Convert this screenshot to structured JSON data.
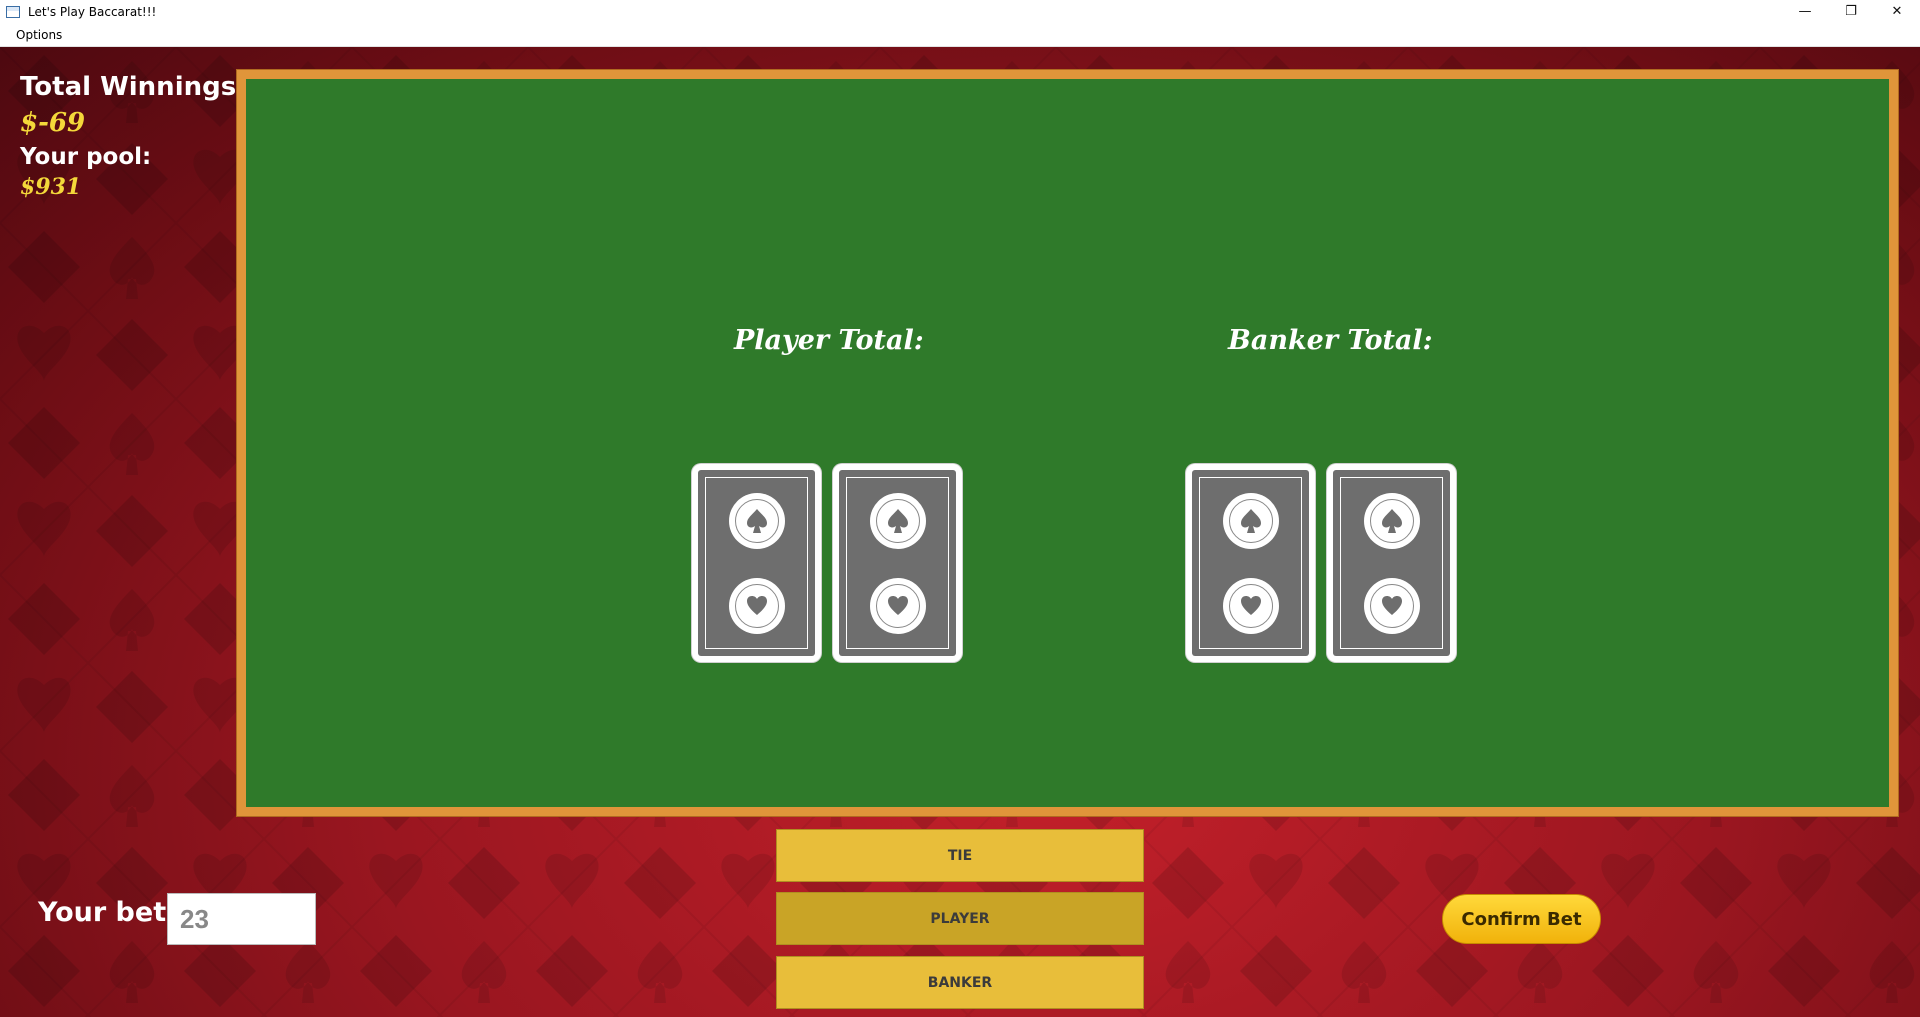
{
  "window": {
    "title": "Let's Play Baccarat!!!",
    "minimize_glyph": "—",
    "restore_glyph": "❐",
    "close_glyph": "✕"
  },
  "menu": {
    "items": [
      {
        "label": "Options"
      }
    ]
  },
  "stats": {
    "winnings_label": "Total Winnings:",
    "winnings_value": "$-69",
    "pool_label": "Your pool:",
    "pool_value": "$931"
  },
  "table": {
    "player_total_label": "Player Total:",
    "banker_total_label": "Banker Total:",
    "player_cards": [
      {
        "face": "back"
      },
      {
        "face": "back"
      }
    ],
    "banker_cards": [
      {
        "face": "back"
      },
      {
        "face": "back"
      }
    ]
  },
  "bet": {
    "label": "Your bet:",
    "value": "23"
  },
  "choices": {
    "tie": "TIE",
    "player": "PLAYER",
    "banker": "BANKER",
    "selected": "PLAYER"
  },
  "confirm": {
    "label": "Confirm Bet"
  },
  "colors": {
    "felt": "#2f7a2a",
    "table_border": "#e0953a",
    "stat_value": "#f4d83a",
    "choice_button": "#e8be3a",
    "confirm_button": "#f1b20b",
    "background_red": "#9a1620"
  }
}
